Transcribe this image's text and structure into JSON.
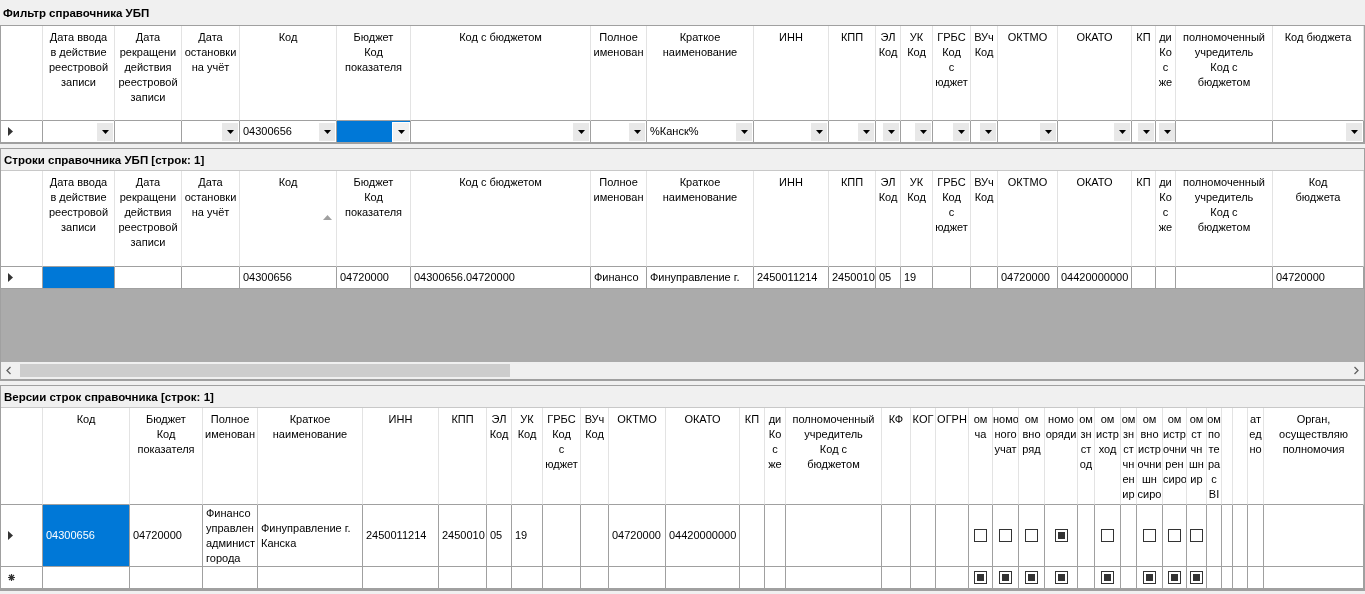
{
  "sections": [
    {
      "title": "Фильтр справочника УБП",
      "columns": [
        {
          "header": "Дата ввода\nв действие\nреестровой\nзаписи"
        },
        {
          "header": "Дата\nрекращени\nдействия\nреестровой\nзаписи"
        },
        {
          "header": "Дата\nостановки\nна учёт"
        },
        {
          "header": "Код"
        },
        {
          "header": "Бюджет\nКод\nпоказателя"
        },
        {
          "header": "Код с бюджетом"
        },
        {
          "header": "Полное\nименован"
        },
        {
          "header": "Краткое\nнаименование"
        },
        {
          "header": "ИНН"
        },
        {
          "header": "КПП"
        },
        {
          "header": "ЭЛ\nКод"
        },
        {
          "header": "УК\nКод"
        },
        {
          "header": "ГРБС\nКод\nс\nюджет"
        },
        {
          "header": "ВУч\nКод"
        },
        {
          "header": "ОКТМО"
        },
        {
          "header": "ОКАТО"
        },
        {
          "header": "КП"
        },
        {
          "header": "ди\nКо\nс\nже"
        },
        {
          "header": "полномоченный\nучредитель\nКод с\nбюджетом"
        },
        {
          "header": "Код бюджета"
        }
      ],
      "rows": [
        {
          "kind": "current",
          "cells": [
            {
              "kind": "combo",
              "selected": false
            },
            {
              "kind": "text",
              "selected": false
            },
            {
              "kind": "combo",
              "selected": false
            },
            {
              "kind": "combo",
              "value": "04300656",
              "selected": false
            },
            {
              "kind": "combo",
              "selected": true
            },
            {
              "kind": "combo",
              "selected": false
            },
            {
              "kind": "combo",
              "selected": false
            },
            {
              "kind": "combo",
              "value": "%Канск%",
              "selected": false
            },
            {
              "kind": "combo",
              "selected": false
            },
            {
              "kind": "combo",
              "selected": false
            },
            {
              "kind": "combo",
              "selected": false
            },
            {
              "kind": "combo",
              "selected": false
            },
            {
              "kind": "combo",
              "selected": false
            },
            {
              "kind": "combo",
              "selected": false
            },
            {
              "kind": "combo",
              "selected": false
            },
            {
              "kind": "combo",
              "selected": false
            },
            {
              "kind": "combo",
              "selected": false
            },
            {
              "kind": "combo",
              "selected": false
            },
            {
              "kind": "text",
              "selected": false
            },
            {
              "kind": "combo",
              "selected": false
            }
          ]
        }
      ]
    },
    {
      "title": "Строки справочника УБП [строк: 1]",
      "columns": [
        {
          "header": "Дата ввода\nв действие\nреестровой\nзаписи"
        },
        {
          "header": "Дата\nрекращени\nдействия\nреестровой\nзаписи"
        },
        {
          "header": "Дата\nостановки\nна учёт"
        },
        {
          "header": "Код",
          "sorted": true
        },
        {
          "header": "Бюджет\nКод\nпоказателя"
        },
        {
          "header": "Код с бюджетом"
        },
        {
          "header": "Полное\nименован"
        },
        {
          "header": "Краткое\nнаименование"
        },
        {
          "header": "ИНН"
        },
        {
          "header": "КПП"
        },
        {
          "header": "ЭЛ\nКод"
        },
        {
          "header": "УК\nКод"
        },
        {
          "header": "ГРБС\nКод\nс\nюджет"
        },
        {
          "header": "ВУч\nКод"
        },
        {
          "header": "ОКТМО"
        },
        {
          "header": "ОКАТО"
        },
        {
          "header": "КП"
        },
        {
          "header": "ди\nКо\nс\nже"
        },
        {
          "header": "полномоченный\nучредитель\nКод с\nбюджетом"
        },
        {
          "header": "Код\nбюджета"
        }
      ],
      "rows": [
        {
          "kind": "current",
          "cells": [
            {
              "kind": "text",
              "selected": true
            },
            {
              "kind": "text",
              "selected": false
            },
            {
              "kind": "text",
              "selected": false
            },
            {
              "kind": "text",
              "value": "04300656",
              "selected": false
            },
            {
              "kind": "text",
              "value": "04720000",
              "selected": false
            },
            {
              "kind": "text",
              "value": "04300656.04720000",
              "selected": false
            },
            {
              "kind": "text",
              "value": "Финансо",
              "selected": false
            },
            {
              "kind": "text",
              "value": "Финуправление г.",
              "selected": false
            },
            {
              "kind": "text",
              "value": "2450011214",
              "selected": false
            },
            {
              "kind": "text",
              "value": "2450010",
              "selected": false
            },
            {
              "kind": "text",
              "value": "05",
              "selected": false
            },
            {
              "kind": "text",
              "value": "19",
              "selected": false
            },
            {
              "kind": "text",
              "selected": false
            },
            {
              "kind": "text",
              "selected": false
            },
            {
              "kind": "text",
              "value": "04720000",
              "selected": false
            },
            {
              "kind": "text",
              "value": "04420000000",
              "selected": false
            },
            {
              "kind": "text",
              "selected": false
            },
            {
              "kind": "text",
              "selected": false
            },
            {
              "kind": "text",
              "selected": false
            },
            {
              "kind": "text",
              "value": "04720000",
              "selected": false
            }
          ]
        }
      ]
    },
    {
      "title": "Версии строк справочника [строк: 1]",
      "columns": [
        {
          "header": "Код"
        },
        {
          "header": "Бюджет\nКод\nпоказателя"
        },
        {
          "header": "Полное\nименован"
        },
        {
          "header": "Краткое\nнаименование"
        },
        {
          "header": "ИНН"
        },
        {
          "header": "КПП"
        },
        {
          "header": "ЭЛ\nКод"
        },
        {
          "header": "УК\nКод"
        },
        {
          "header": "ГРБС\nКод\nс\nюджет"
        },
        {
          "header": "ВУч\nКод"
        },
        {
          "header": "ОКТМО"
        },
        {
          "header": "ОКАТО"
        },
        {
          "header": "КП"
        },
        {
          "header": "ди\nКо\nс\nже"
        },
        {
          "header": "полномоченный\nучредитель\nКод с\nбюджетом"
        },
        {
          "header": "КФ"
        },
        {
          "header": "КОГ"
        },
        {
          "header": "ОГРН"
        },
        {
          "header": "ом\nча"
        },
        {
          "header": "номо\nного\nучат"
        },
        {
          "header": "ом\nвно\nряд"
        },
        {
          "header": "номо\nоряди"
        },
        {
          "header": "ом\nзн\nст\nод"
        },
        {
          "header": "ом\nистр\nход"
        },
        {
          "header": "ом\nзн\nст\nчн\nен\nир"
        },
        {
          "header": "ом\nвно\nистр\nочни\nшн\nсиро"
        },
        {
          "header": "ом\nистр\nочни\nрен\nсиро"
        },
        {
          "header": "ом\nст\nчн\nшн\nир"
        },
        {
          "header": "ом\nпо\nте\nра\nс\nВІ"
        },
        {},
        {},
        {
          "header": "ат\nед\nно"
        },
        {
          "header": "Орган,\nосуществляю\nполномочия"
        }
      ],
      "rows": [
        {
          "kind": "current",
          "cells": [
            {
              "kind": "text",
              "value": "04300656",
              "selected": true
            },
            {
              "kind": "text",
              "value": "04720000",
              "selected": false
            },
            {
              "kind": "text",
              "value": "Финансо\nуправлен\nадминист\nгорода",
              "selected": false
            },
            {
              "kind": "text",
              "value": "Финуправление г. Канска",
              "selected": false
            },
            {
              "kind": "text",
              "value": "2450011214",
              "selected": false
            },
            {
              "kind": "text",
              "value": "2450010",
              "selected": false
            },
            {
              "kind": "text",
              "value": "05",
              "selected": false
            },
            {
              "kind": "text",
              "value": "19",
              "selected": false
            },
            {
              "kind": "text",
              "selected": false
            },
            {
              "kind": "text",
              "selected": false
            },
            {
              "kind": "text",
              "value": "04720000",
              "selected": false
            },
            {
              "kind": "text",
              "value": "04420000000",
              "selected": false
            },
            {
              "kind": "text",
              "selected": false
            },
            {
              "kind": "text",
              "selected": false
            },
            {
              "kind": "text",
              "selected": false
            },
            {
              "kind": "text",
              "selected": false
            },
            {
              "kind": "text",
              "selected": false
            },
            {
              "kind": "text",
              "selected": false
            },
            {
              "kind": "check",
              "checked": false,
              "selected": false
            },
            {
              "kind": "check",
              "checked": false,
              "selected": false
            },
            {
              "kind": "check",
              "checked": false,
              "selected": false
            },
            {
              "kind": "check",
              "checked": true,
              "selected": false
            },
            {
              "kind": "text",
              "selected": false
            },
            {
              "kind": "check",
              "checked": false,
              "selected": false
            },
            {
              "kind": "text",
              "selected": false
            },
            {
              "kind": "check",
              "checked": false,
              "selected": false
            },
            {
              "kind": "check",
              "checked": false,
              "selected": false
            },
            {
              "kind": "check",
              "checked": false,
              "selected": false
            },
            {
              "kind": "text",
              "selected": false
            },
            {
              "kind": "text",
              "selected": false
            },
            {
              "kind": "text",
              "selected": false
            },
            {
              "kind": "text",
              "selected": false
            },
            {
              "kind": "text",
              "selected": false
            }
          ]
        },
        {
          "kind": "new",
          "cells": [
            {
              "kind": "text",
              "selected": false
            },
            {
              "kind": "text",
              "selected": false
            },
            {
              "kind": "text",
              "selected": false
            },
            {
              "kind": "text",
              "selected": false
            },
            {
              "kind": "text",
              "selected": false
            },
            {
              "kind": "text",
              "selected": false
            },
            {
              "kind": "text",
              "selected": false
            },
            {
              "kind": "text",
              "selected": false
            },
            {
              "kind": "text",
              "selected": false
            },
            {
              "kind": "text",
              "selected": false
            },
            {
              "kind": "text",
              "selected": false
            },
            {
              "kind": "text",
              "selected": false
            },
            {
              "kind": "text",
              "selected": false
            },
            {
              "kind": "text",
              "selected": false
            },
            {
              "kind": "text",
              "selected": false
            },
            {
              "kind": "text",
              "selected": false
            },
            {
              "kind": "text",
              "selected": false
            },
            {
              "kind": "text",
              "selected": false
            },
            {
              "kind": "check",
              "checked": true,
              "selected": false
            },
            {
              "kind": "check",
              "checked": true,
              "selected": false
            },
            {
              "kind": "check",
              "checked": true,
              "selected": false
            },
            {
              "kind": "check",
              "checked": true,
              "selected": false
            },
            {
              "kind": "text",
              "selected": false
            },
            {
              "kind": "check",
              "checked": true,
              "selected": false
            },
            {
              "kind": "text",
              "selected": false
            },
            {
              "kind": "check",
              "checked": true,
              "selected": false
            },
            {
              "kind": "check",
              "checked": true,
              "selected": false
            },
            {
              "kind": "check",
              "checked": true,
              "selected": false
            },
            {
              "kind": "text",
              "selected": false
            },
            {
              "kind": "text",
              "selected": false
            },
            {
              "kind": "text",
              "selected": false
            },
            {
              "kind": "text",
              "selected": false
            },
            {
              "kind": "text",
              "selected": false
            }
          ]
        }
      ]
    }
  ]
}
